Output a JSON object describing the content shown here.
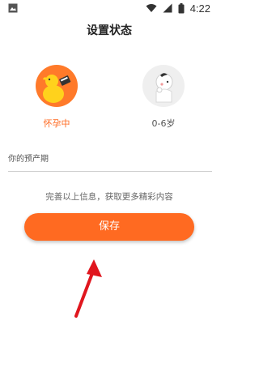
{
  "status_bar": {
    "time": "4:22",
    "icons": [
      "image-icon",
      "wifi-icon",
      "signal-icon",
      "battery-icon"
    ]
  },
  "page": {
    "title": "设置状态"
  },
  "options": [
    {
      "label": "怀孕中",
      "icon": "pregnant-avatar-icon",
      "selected": true
    },
    {
      "label": "0-6岁",
      "icon": "baby-avatar-icon",
      "selected": false
    }
  ],
  "due_date": {
    "placeholder": "你的预产期"
  },
  "hint": "完善以上信息，获取更多精彩内容",
  "save_button": {
    "label": "保存"
  },
  "colors": {
    "accent": "#ff6a21",
    "arrow": "#e0161e"
  }
}
